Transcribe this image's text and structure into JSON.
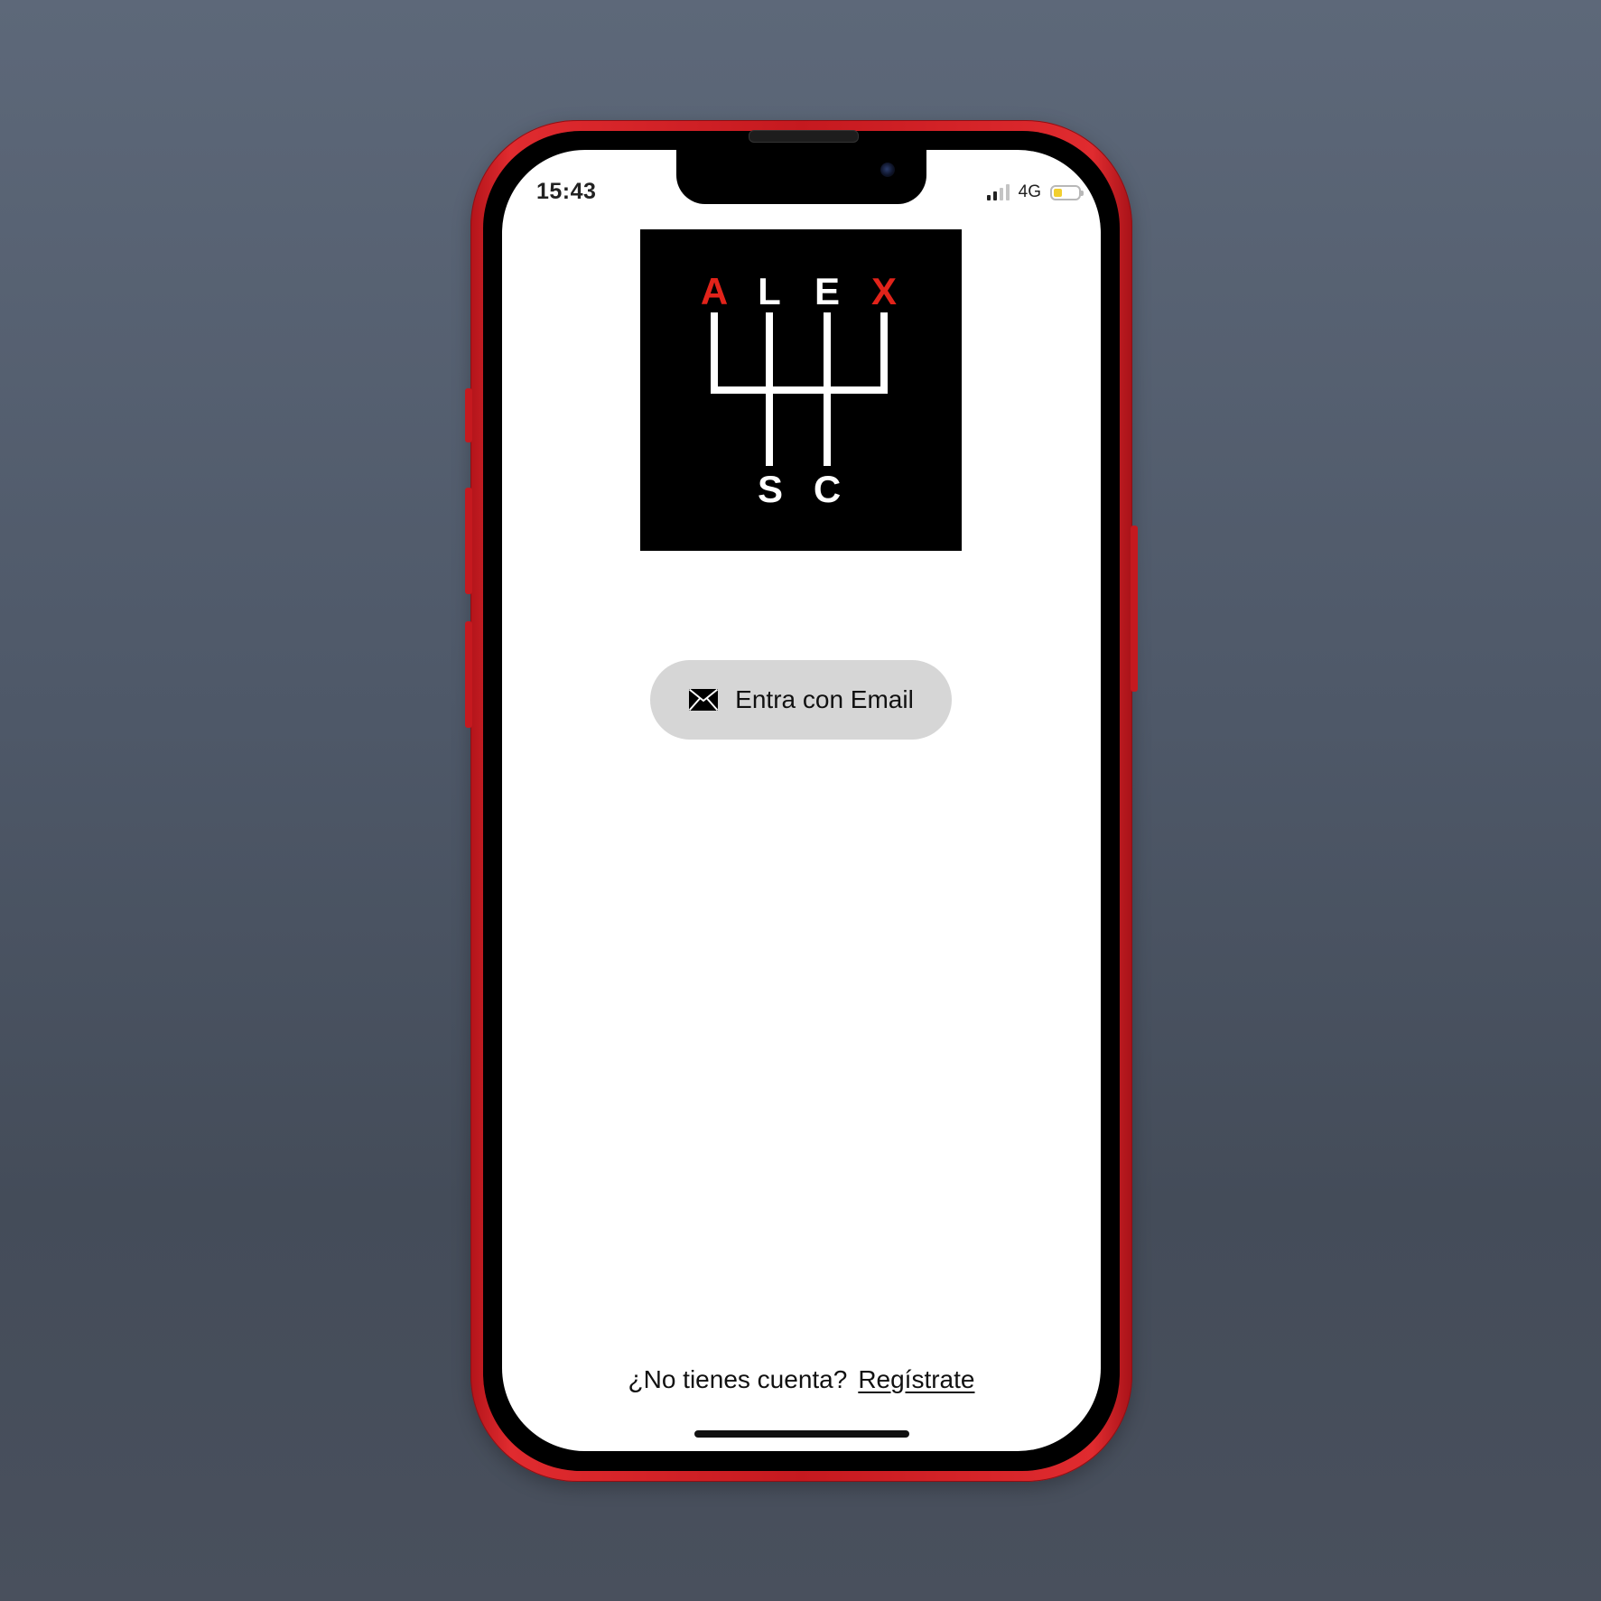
{
  "status_bar": {
    "time": "15:43",
    "network": "4G",
    "signal_bars_active": 2,
    "signal_bars_total": 4,
    "battery_level": 0.35,
    "battery_color": "#f2cf2e"
  },
  "logo": {
    "letters_top": [
      "A",
      "L",
      "E",
      "X"
    ],
    "letters_bottom": [
      "S",
      "C"
    ],
    "accent_color": "#e2231a",
    "primary_color": "#ffffff",
    "background_color": "#000000"
  },
  "login": {
    "email_button_label": "Entra con Email",
    "email_icon": "envelope-icon"
  },
  "footer": {
    "prompt": "¿No tienes cuenta?",
    "signup_link": "Regístrate"
  },
  "device": {
    "frame_color": "#c5191f"
  }
}
